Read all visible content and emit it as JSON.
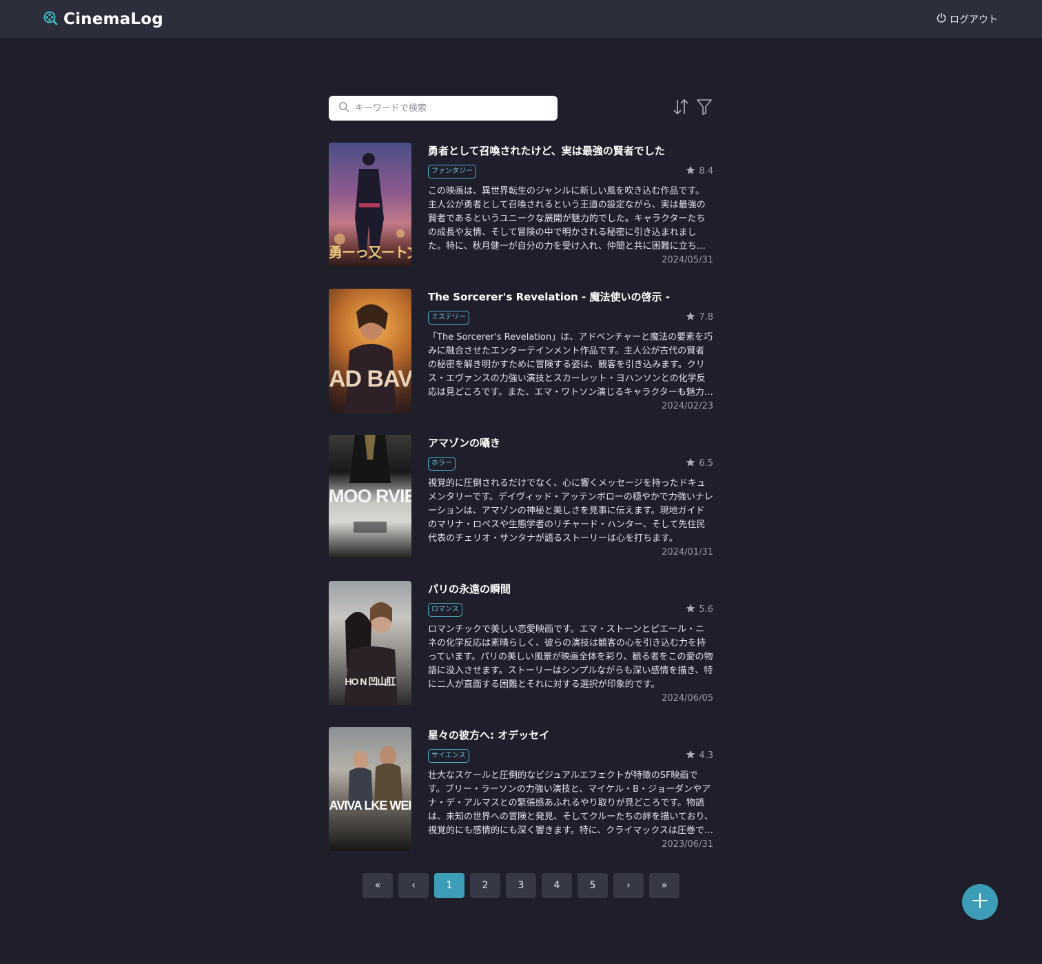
{
  "header": {
    "brand": "CinemaLog",
    "logout_label": "ログアウト"
  },
  "search": {
    "placeholder": "キーワードで検索",
    "value": ""
  },
  "icons": {
    "brand": "film-reel-search-icon",
    "logout": "power-icon",
    "search": "search-icon",
    "sort": "sort-arrows-icon",
    "filter": "filter-icon",
    "rating": "star-icon",
    "add": "plus-icon"
  },
  "colors": {
    "accent": "#3d9db6",
    "background": "#1e1f2b",
    "header": "#2c2e3b"
  },
  "movies": [
    {
      "title": "勇者として召喚されたけど、実は最強の賢者でした",
      "genre": "ファンタジー",
      "rating": "8.4",
      "description": "この映画は、異世界転生のジャンルに新しい風を吹き込む作品です。主人公が勇者として召喚されるという王道の設定ながら、実は最強の賢者であるというユニークな展開が魅力的でした。キャラクターたちの成長や友情、そして冒険の中で明かされる秘密に引き込まれました。特に、秋月健一が自分の力を受け入れ、仲間と共に困難に立ち向かう姿は感動的です。",
      "date": "2024/05/31",
      "poster_text": "勇ーっ又ート文!"
    },
    {
      "title": "The Sorcerer's Revelation - 魔法使いの啓示 -",
      "genre": "ミステリー",
      "rating": "7.8",
      "description": "「The Sorcerer's Revelation」は、アドベンチャーと魔法の要素を巧みに融合させたエンターテインメント作品です。主人公が古代の賢者の秘密を解き明かすために冒険する姿は、観客を引き込みます。クリス・エヴァンスの力強い演技とスカーレット・ヨハンソンとの化学反応は見どころです。また、エマ・ワトソン演じるキャラクターも魅力的です。",
      "date": "2024/02/23",
      "poster_text": "AD BAV"
    },
    {
      "title": "アマゾンの囁き",
      "genre": "ホラー",
      "rating": "6.5",
      "description": "視覚的に圧倒されるだけでなく、心に響くメッセージを持ったドキュメンタリーです。デイヴィッド・アッテンボローの穏やかで力強いナレーションは、アマゾンの神秘と美しさを見事に伝えます。現地ガイドのマリナ・ロペスや生態学者のリチャード・ハンター、そして先住民代表のチェリオ・サンタナが語るストーリーは心を打ちます。",
      "date": "2024/01/31",
      "poster_text": "MOO RVIE"
    },
    {
      "title": "パリの永遠の瞬間",
      "genre": "ロマンス",
      "rating": "5.6",
      "description": "ロマンチックで美しい恋愛映画です。エマ・ストーンとピエール・ニネの化学反応は素晴らしく、彼らの演技は観客の心を引き込む力を持っています。パリの美しい風景が映画全体を彩り、観る者をこの愛の物語に没入させます。ストーリーはシンプルながらも深い感情を描き、特に二人が直面する困難とそれに対する選択が印象的です。",
      "date": "2024/06/05",
      "poster_text": "HO N 凹山肛"
    },
    {
      "title": "星々の彼方へ: オデッセイ",
      "genre": "サイエンス",
      "rating": "4.3",
      "description": "壮大なスケールと圧倒的なビジュアルエフェクトが特徴のSF映画です。ブリー・ラーソンの力強い演技と、マイケル・B・ジョーダンやアナ・デ・アルマスとの緊張感あふれるやり取りが見どころです。物語は、未知の世界への冒険と発見、そしてクルーたちの絆を描いており、視覚的にも感情的にも深く響きます。特に、クライマックスは圧巻です。",
      "date": "2023/06/31",
      "poster_text": "AVIVA LKE WEI"
    }
  ],
  "pagination": {
    "first": "«",
    "prev": "‹",
    "pages": [
      "1",
      "2",
      "3",
      "4",
      "5"
    ],
    "current": "1",
    "next": "›",
    "last": "»"
  }
}
